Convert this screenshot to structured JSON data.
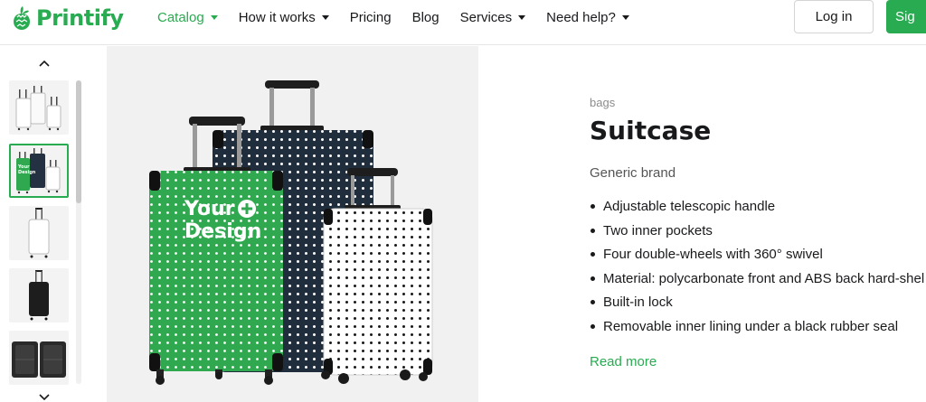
{
  "brand": {
    "name": "Printify",
    "accent": "#29ab51"
  },
  "nav": {
    "items": [
      {
        "label": "Catalog",
        "dropdown": true,
        "active": true
      },
      {
        "label": "How it works",
        "dropdown": true
      },
      {
        "label": "Pricing",
        "dropdown": false
      },
      {
        "label": "Blog",
        "dropdown": false
      },
      {
        "label": "Services",
        "dropdown": true
      },
      {
        "label": "Need help?",
        "dropdown": true
      }
    ],
    "login": "Log in",
    "signup": "Sig"
  },
  "gallery": {
    "thumbnails": [
      {
        "variant": "white-set",
        "selected": false
      },
      {
        "variant": "green-design-set",
        "selected": true
      },
      {
        "variant": "white-single",
        "selected": false
      },
      {
        "variant": "black-single",
        "selected": false
      },
      {
        "variant": "open-interior",
        "selected": false
      }
    ],
    "main_image_text": "Your Design",
    "main_text_line1": "Your",
    "main_text_line2": "Design"
  },
  "product": {
    "category": "bags",
    "title": "Suitcase",
    "brand": "Generic brand",
    "features": [
      "Adjustable telescopic handle",
      "Two inner pockets",
      "Four double-wheels with 360° swivel",
      "Material: polycarbonate front and ABS back hard-shel",
      "Built-in lock",
      "Removable inner lining under a black rubber seal"
    ],
    "read_more": "Read more"
  }
}
